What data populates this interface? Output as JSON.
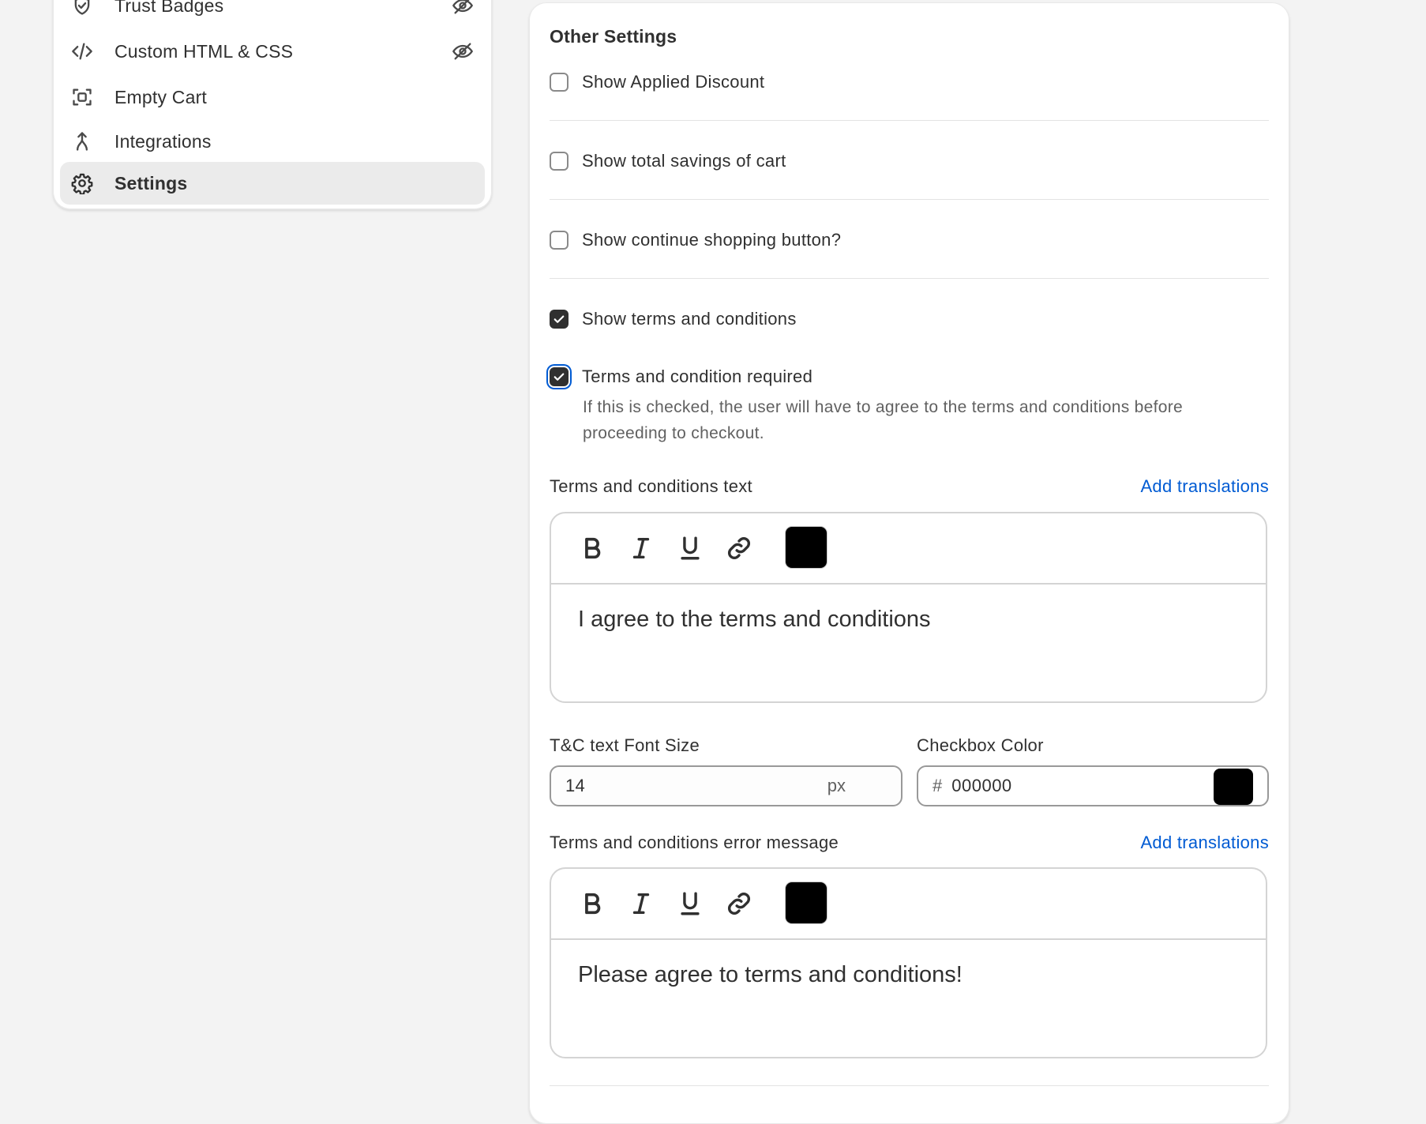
{
  "sidebar": {
    "items": [
      {
        "label": "Trust Badges",
        "icon": "shield-check-icon",
        "hidden_icon": "eye-off-icon"
      },
      {
        "label": "Custom HTML & CSS",
        "icon": "code-icon",
        "hidden_icon": "eye-off-icon"
      },
      {
        "label": "Empty Cart",
        "icon": "frame-icon"
      },
      {
        "label": "Integrations",
        "icon": "integration-icon"
      },
      {
        "label": "Settings",
        "icon": "gear-icon",
        "active": true
      }
    ]
  },
  "main": {
    "section_title": "Other Settings",
    "options": [
      {
        "label": "Show Applied Discount",
        "checked": false
      },
      {
        "label": "Show total savings of cart",
        "checked": false
      },
      {
        "label": "Show continue shopping button?",
        "checked": false
      },
      {
        "label": "Show terms and conditions",
        "checked": true
      },
      {
        "label": "Terms and condition required",
        "checked": true,
        "focused": true
      }
    ],
    "required_help": "If this is checked, the user will have to agree to the terms and conditions before proceeding to checkout.",
    "tc_text": {
      "label": "Terms and conditions text",
      "translations_link": "Add translations",
      "content": "I agree to the terms and conditions",
      "color": "#000000"
    },
    "font_size": {
      "label": "T&C text Font Size",
      "value": "14",
      "suffix": "px"
    },
    "checkbox_color": {
      "label": "Checkbox Color",
      "prefix": "#",
      "value": "000000",
      "swatch": "#000000"
    },
    "error_message": {
      "label": "Terms and conditions error message",
      "translations_link": "Add translations",
      "content": "Please agree to terms and conditions!",
      "color": "#000000"
    },
    "toolbar_buttons": [
      "bold-icon",
      "italic-icon",
      "underline-icon",
      "link-icon",
      "text-color-swatch"
    ]
  },
  "colors": {
    "accent_link": "#005bd3",
    "text": "#303030",
    "muted": "#616161",
    "page_bg": "#f3f3f3"
  }
}
